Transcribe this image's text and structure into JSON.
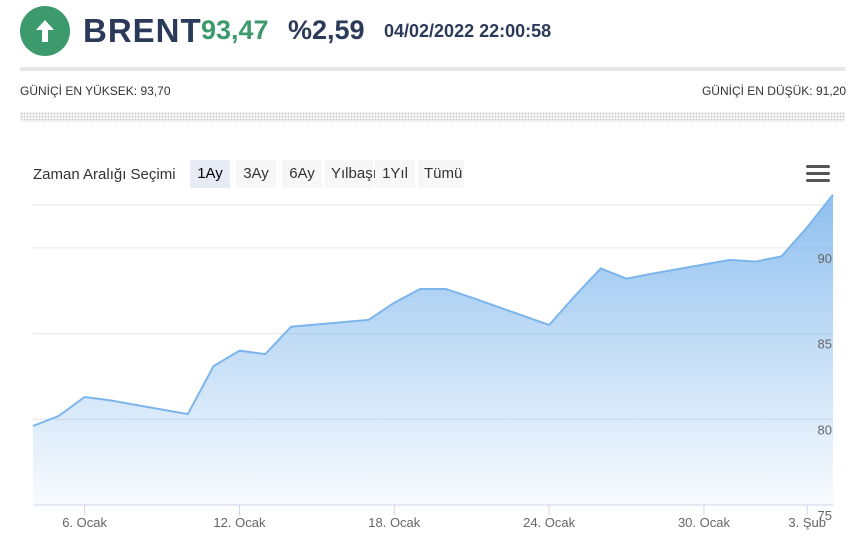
{
  "header": {
    "direction_icon": "arrow-up-icon",
    "title": "BRENT",
    "price": "93,47",
    "change": "%2,59",
    "datetime": "04/02/2022 22:00:58",
    "colors": {
      "up": "#3d9a6c",
      "title": "#2c3a5a"
    }
  },
  "range": {
    "high_label": "GÜNİÇİ EN YÜKSEK: 93,70",
    "low_label": "GÜNİÇİ EN DÜŞÜK: 91,20"
  },
  "toolbar": {
    "label": "Zaman Aralığı Seçimi",
    "buttons": [
      "1Ay",
      "3Ay",
      "6Ay",
      "Yılbaşı",
      "1Yıl",
      "Tümü"
    ],
    "selected": "1Ay",
    "menu_icon": "hamburger-menu-icon"
  },
  "chart_data": {
    "type": "area",
    "x": [
      "2022-01-04",
      "2022-01-05",
      "2022-01-06",
      "2022-01-07",
      "2022-01-10",
      "2022-01-11",
      "2022-01-12",
      "2022-01-13",
      "2022-01-14",
      "2022-01-17",
      "2022-01-18",
      "2022-01-19",
      "2022-01-20",
      "2022-01-21",
      "2022-01-24",
      "2022-01-25",
      "2022-01-26",
      "2022-01-27",
      "2022-01-28",
      "2022-01-31",
      "2022-02-01",
      "2022-02-02",
      "2022-02-03",
      "2022-02-04"
    ],
    "values": [
      79.6,
      80.2,
      81.3,
      81.1,
      80.3,
      83.1,
      84.0,
      83.8,
      85.4,
      85.8,
      86.8,
      87.6,
      87.6,
      87.1,
      85.5,
      87.2,
      88.8,
      88.2,
      88.5,
      89.3,
      89.2,
      89.5,
      91.2,
      93.1
    ],
    "x_tick_labels": [
      "6. Ocak",
      "12. Ocak",
      "18. Ocak",
      "24. Ocak",
      "30. Ocak",
      "3. Şub"
    ],
    "y_ticks": [
      75,
      80,
      85,
      90
    ],
    "ylim": [
      75,
      92.5
    ],
    "grid": true,
    "line_color": "#7cb5ec"
  }
}
